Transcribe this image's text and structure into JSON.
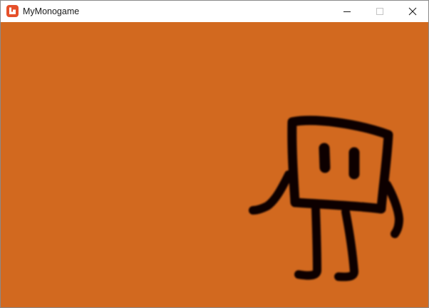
{
  "window": {
    "title": "MyMonogame",
    "icon": "monogame-logo-icon",
    "buttons": {
      "minimize": "minimize-icon",
      "maximize": "maximize-icon",
      "close": "close-icon"
    }
  },
  "colors": {
    "titlebar": "#ffffff",
    "canvas_background": "#d2691f",
    "sprite_ink": "#0b0604",
    "logo": "#e6502a"
  },
  "game": {
    "sprite": "hand-drawn-box-character"
  }
}
